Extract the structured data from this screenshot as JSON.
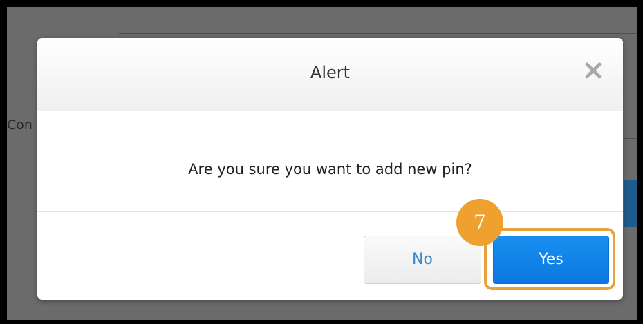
{
  "background": {
    "partial_label": "Con"
  },
  "dialog": {
    "title": "Alert",
    "close_icon": "close-icon",
    "message": "Are you sure you want to add new pin?",
    "buttons": {
      "no_label": "No",
      "yes_label": "Yes"
    }
  },
  "annotation": {
    "step_number": "7",
    "highlight_color": "#e9a13b",
    "badge_color": "#efa12f"
  },
  "colors": {
    "primary_button": "#0a78e0",
    "overlay": "#6b6b6b"
  }
}
